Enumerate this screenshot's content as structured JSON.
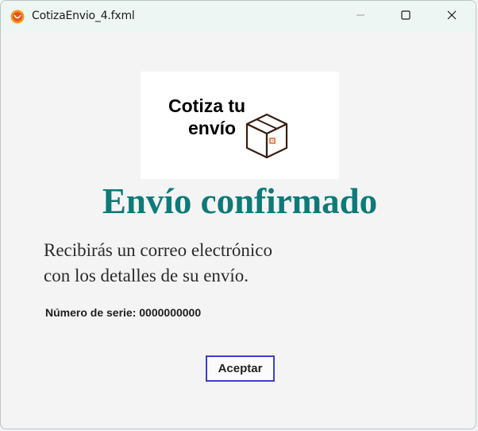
{
  "window": {
    "title": "CotizaEnvio_4.fxml",
    "icons": {
      "app": "app-icon",
      "minimize": "minimize-icon",
      "maximize": "maximize-icon",
      "close": "close-icon"
    }
  },
  "logo": {
    "line1": "Cotiza tu",
    "line2": "envío",
    "icon": "box-icon"
  },
  "content": {
    "heading": "Envío confirmado",
    "message_line1": "Recibirás un correo electrónico",
    "message_line2": "con los detalles de su envío.",
    "serial_label": "Número de serie: 0000000000",
    "accept_label": "Aceptar"
  },
  "colors": {
    "heading": "#0e7a78",
    "button_border": "#3c3cd6",
    "titlebar": "#eef6f3",
    "app_icon": "#f29c1f"
  }
}
